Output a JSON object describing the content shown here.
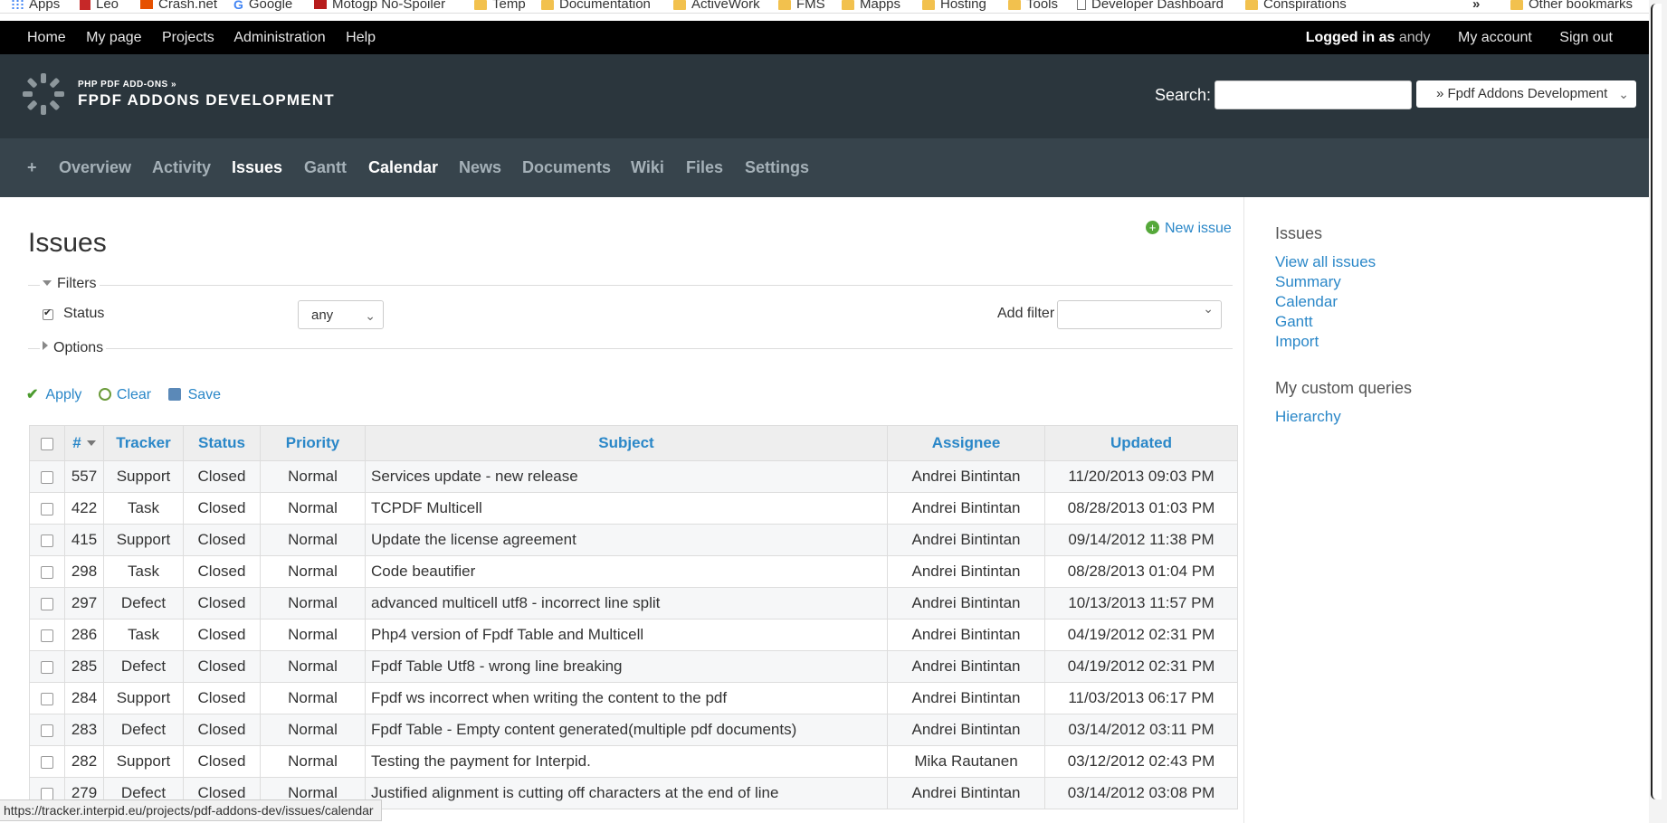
{
  "bookmarks": [
    {
      "label": "Apps",
      "icon": "apps-icon"
    },
    {
      "label": "Leo",
      "icon": "flag-icon"
    },
    {
      "label": "Crash.net",
      "icon": "crash-icon"
    },
    {
      "label": "Google",
      "icon": "google-icon"
    },
    {
      "label": "Motogp No-Spoiler",
      "icon": "motogp-icon"
    },
    {
      "label": "Temp",
      "icon": "folder-icon"
    },
    {
      "label": "Documentation",
      "icon": "folder-icon"
    },
    {
      "label": "ActiveWork",
      "icon": "folder-icon"
    },
    {
      "label": "FMS",
      "icon": "folder-icon"
    },
    {
      "label": "Mapps",
      "icon": "folder-icon"
    },
    {
      "label": "Hosting",
      "icon": "folder-icon"
    },
    {
      "label": "Tools",
      "icon": "folder-icon"
    },
    {
      "label": "Developer Dashboard",
      "icon": "page-icon"
    },
    {
      "label": "Conspirations",
      "icon": "folder-icon"
    },
    {
      "label": "»",
      "icon": ""
    },
    {
      "label": "Other bookmarks",
      "icon": "folder-icon"
    }
  ],
  "topbar": {
    "menu": [
      "Home",
      "My page",
      "Projects",
      "Administration",
      "Help"
    ],
    "logged_in_as": "Logged in as",
    "user": "andy",
    "my_account": "My account",
    "sign_out": "Sign out"
  },
  "header": {
    "parent_project": "PHP PDF ADD-ONS »",
    "project_title": "FPDF ADDONS DEVELOPMENT",
    "search_label": "Search:",
    "search_value": "",
    "project_jump": "» Fpdf Addons Development"
  },
  "nav": {
    "tabs": [
      {
        "label": "+"
      },
      {
        "label": "Overview"
      },
      {
        "label": "Activity"
      },
      {
        "label": "Issues"
      },
      {
        "label": "Gantt"
      },
      {
        "label": "Calendar"
      },
      {
        "label": "News"
      },
      {
        "label": "Documents"
      },
      {
        "label": "Wiki"
      },
      {
        "label": "Files"
      },
      {
        "label": "Settings"
      }
    ]
  },
  "main": {
    "title": "Issues",
    "new_issue": "New issue",
    "filters_legend": "Filters",
    "status_label": "Status",
    "status_operator": "any",
    "add_filter_label": "Add filter",
    "options_legend": "Options",
    "actions": {
      "apply": "Apply",
      "clear": "Clear",
      "save": "Save"
    },
    "table": {
      "headers": {
        "id": "#",
        "tracker": "Tracker",
        "status": "Status",
        "priority": "Priority",
        "subject": "Subject",
        "assignee": "Assignee",
        "updated": "Updated"
      },
      "rows": [
        {
          "id": "557",
          "tracker": "Support",
          "status": "Closed",
          "priority": "Normal",
          "subject": "Services update - new release",
          "assignee": "Andrei Bintintan",
          "updated": "11/20/2013 09:03 PM"
        },
        {
          "id": "422",
          "tracker": "Task",
          "status": "Closed",
          "priority": "Normal",
          "subject": "TCPDF Multicell",
          "assignee": "Andrei Bintintan",
          "updated": "08/28/2013 01:03 PM"
        },
        {
          "id": "415",
          "tracker": "Support",
          "status": "Closed",
          "priority": "Normal",
          "subject": "Update the license agreement",
          "assignee": "Andrei Bintintan",
          "updated": "09/14/2012 11:38 PM"
        },
        {
          "id": "298",
          "tracker": "Task",
          "status": "Closed",
          "priority": "Normal",
          "subject": "Code beautifier",
          "assignee": "Andrei Bintintan",
          "updated": "08/28/2013 01:04 PM"
        },
        {
          "id": "297",
          "tracker": "Defect",
          "status": "Closed",
          "priority": "Normal",
          "subject": "advanced multicell utf8 - incorrect line split",
          "assignee": "Andrei Bintintan",
          "updated": "10/13/2013 11:57 PM"
        },
        {
          "id": "286",
          "tracker": "Task",
          "status": "Closed",
          "priority": "Normal",
          "subject": "Php4 version of Fpdf Table and Multicell",
          "assignee": "Andrei Bintintan",
          "updated": "04/19/2012 02:31 PM"
        },
        {
          "id": "285",
          "tracker": "Defect",
          "status": "Closed",
          "priority": "Normal",
          "subject": "Fpdf Table Utf8 - wrong line breaking",
          "assignee": "Andrei Bintintan",
          "updated": "04/19/2012 02:31 PM"
        },
        {
          "id": "284",
          "tracker": "Support",
          "status": "Closed",
          "priority": "Normal",
          "subject": "Fpdf ws incorrect when writing the content to the pdf",
          "assignee": "Andrei Bintintan",
          "updated": "11/03/2013 06:17 PM"
        },
        {
          "id": "283",
          "tracker": "Defect",
          "status": "Closed",
          "priority": "Normal",
          "subject": "Fpdf Table - Empty content generated(multiple pdf documents)",
          "assignee": "Andrei Bintintan",
          "updated": "03/14/2012 03:11 PM"
        },
        {
          "id": "282",
          "tracker": "Support",
          "status": "Closed",
          "priority": "Normal",
          "subject": "Testing the payment for Interpid.",
          "assignee": "Mika Rautanen",
          "updated": "03/12/2012 02:43 PM"
        },
        {
          "id": "279",
          "tracker": "Defect",
          "status": "Closed",
          "priority": "Normal",
          "subject": "Justified alignment is cutting off characters at the end of line",
          "assignee": "Andrei Bintintan",
          "updated": "03/14/2012 03:08 PM"
        }
      ]
    },
    "status_url": "https://tracker.interpid.eu/projects/pdf-addons-dev/issues/calendar"
  },
  "sidebar": {
    "issues_heading": "Issues",
    "links": [
      "View all issues",
      "Summary",
      "Calendar",
      "Gantt",
      "Import"
    ],
    "queries_heading": "My custom queries",
    "queries": [
      "Hierarchy"
    ]
  },
  "colors": {
    "accent": "#2a87c8",
    "header_bg": "#2b363d",
    "nav_bg": "#37444c",
    "topbar_bg": "#000000"
  }
}
